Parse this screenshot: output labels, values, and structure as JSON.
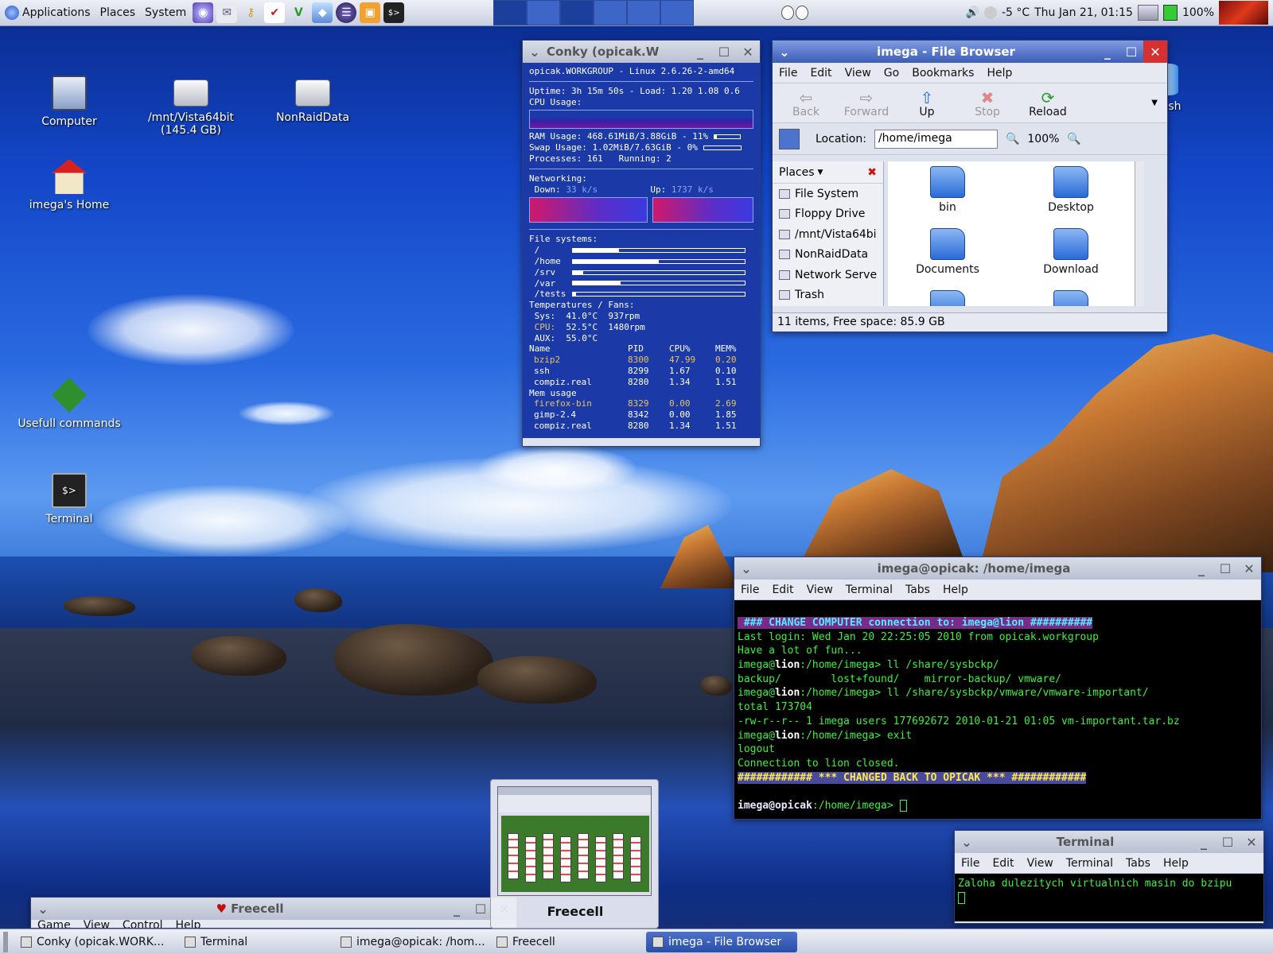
{
  "top_panel": {
    "menus": [
      "Applications",
      "Places",
      "System"
    ],
    "tray": {
      "weather": "-5 °C",
      "clock": "Thu Jan 21, 01:15",
      "battery": "100%"
    }
  },
  "desktop_icons": [
    {
      "label": "Computer"
    },
    {
      "label": "/mnt/Vista64bit",
      "sublabel": "(145.4 GB)"
    },
    {
      "label": "NonRaidData"
    },
    {
      "label": "imega's Home"
    },
    {
      "label": "Usefull commands"
    },
    {
      "label": "Terminal"
    },
    {
      "label": "Trash"
    }
  ],
  "conky": {
    "title": "Conky (opicak.W",
    "lines": {
      "host": "opicak.WORKGROUP - Linux 2.6.26-2-amd64",
      "uptime": "Uptime: 3h 15m 50s - Load: 1.20 1.08 0.6",
      "cpu_label": "CPU Usage:",
      "ram": "RAM Usage: 468.61MiB/3.88GiB - 11%",
      "swap": "Swap Usage: 1.02MiB/7.63GiB - 0%",
      "procs": "Processes: 161   Running: 2",
      "net_label": "Networking:",
      "net_down_label": " Down:",
      "net_down_value": "33 k/s",
      "net_up_label": "Up:",
      "net_up_value": "1737 k/s",
      "fs_label": "File systems:",
      "temps_label": "Temperatures / Fans:",
      "sys": " Sys:  41.0°C  937rpm",
      "cpu_t_label": " CPU:",
      "cpu_t": "  52.5°C  1480rpm",
      "aux": " AUX:  55.0°C"
    },
    "filesystems": [
      {
        "mount": " /",
        "used": 0.27
      },
      {
        "mount": " /home",
        "used": 0.5
      },
      {
        "mount": " /srv",
        "used": 0.06
      },
      {
        "mount": " /var",
        "used": 0.28
      },
      {
        "mount": " /tests",
        "used": 0.02
      }
    ],
    "ram_used": 0.11,
    "swap_used": 0.0,
    "proc_header": [
      "Name",
      "PID",
      "CPU%",
      "MEM%"
    ],
    "cpu_procs": [
      [
        "bzip2",
        "8300",
        "47.99",
        "0.20"
      ],
      [
        "ssh",
        "8299",
        "1.67",
        "0.10"
      ],
      [
        "compiz.real",
        "8280",
        "1.34",
        "1.51"
      ]
    ],
    "mem_label": "Mem usage",
    "mem_procs": [
      [
        "firefox-bin",
        "8329",
        "0.00",
        "2.69"
      ],
      [
        "gimp-2.4",
        "8342",
        "0.00",
        "1.85"
      ],
      [
        "compiz.real",
        "8280",
        "1.34",
        "1.51"
      ]
    ]
  },
  "file_browser": {
    "title": "imega - File Browser",
    "menus": [
      "File",
      "Edit",
      "View",
      "Go",
      "Bookmarks",
      "Help"
    ],
    "toolbar": [
      "Back",
      "Forward",
      "Up",
      "Stop",
      "Reload"
    ],
    "location_label": "Location:",
    "location": "/home/imega",
    "zoom": "100%",
    "places_header": "Places",
    "places": [
      "File System",
      "Floppy Drive",
      "/mnt/Vista64bi",
      "NonRaidData",
      "Network Serve",
      "Trash"
    ],
    "items": [
      "bin",
      "Desktop",
      "Documents",
      "Download"
    ],
    "status": "11 items, Free space: 85.9 GB"
  },
  "terminal_main": {
    "title": "imega@opicak: /home/imega",
    "menus": [
      "File",
      "Edit",
      "View",
      "Terminal",
      "Tabs",
      "Help"
    ],
    "lines": {
      "l1": " ### CHANGE COMPUTER connection to: imega@lion ##########",
      "l2": "Last login: Wed Jan 20 22:25:05 2010 from opicak.workgroup",
      "l3": "Have a lot of fun...",
      "l4_user": "imega@",
      "l4_host": "lion",
      "l4_rest": ":/home/imega> ll /share/sysbckp/",
      "l5": "backup/        lost+found/    mirror-backup/ vmware/",
      "l6_user": "imega@",
      "l6_host": "lion",
      "l6_rest": ":/home/imega> ll /share/sysbckp/vmware/vmware-important/",
      "l7": "total 173704",
      "l8": "-rw-r--r-- 1 imega users 177692672 2010-01-21 01:05 vm-important.tar.bz",
      "l9_user": "imega@",
      "l9_host": "lion",
      "l9_rest": ":/home/imega> exit",
      "l10": "logout",
      "l11": "Connection to lion closed.",
      "l12": "############ *** CHANGED BACK TO OPICAK *** ############",
      "l13_user": "imega@opicak",
      "l13_rest": ":/home/imega> "
    }
  },
  "terminal_small": {
    "title": "Terminal",
    "menus": [
      "File",
      "Edit",
      "View",
      "Terminal",
      "Tabs",
      "Help"
    ],
    "line": "Zaloha dulezitych virtualnich masin do bzipu"
  },
  "freecell": {
    "title": "Freecell",
    "menus": [
      "Game",
      "View",
      "Control",
      "Help"
    ],
    "preview_label": "Freecell"
  },
  "taskbar": [
    {
      "label": "Conky (opicak.WORK...",
      "active": false
    },
    {
      "label": "Terminal",
      "active": false
    },
    {
      "label": "imega@opicak: /hom...",
      "active": false
    },
    {
      "label": "Freecell",
      "active": false
    },
    {
      "label": "imega - File Browser",
      "active": true
    }
  ],
  "colors": {
    "panel": "#c9cfe0",
    "titlebar_active": "#3c5db8",
    "conky_bg": "#1b3aa8",
    "terminal_fg": "#3cf03c"
  }
}
